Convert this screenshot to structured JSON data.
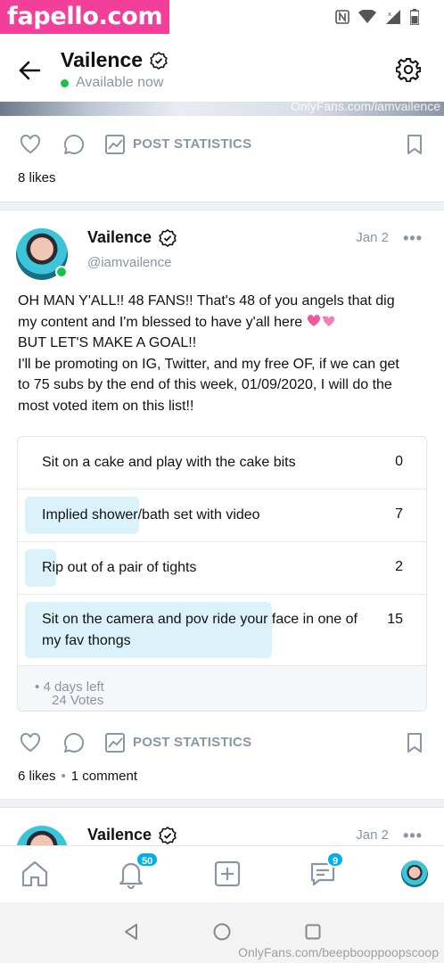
{
  "statusbar": {
    "brand": "fapello.com",
    "nfc_icon": "nfc-icon",
    "wifi_icon": "wifi-icon",
    "signal_icon": "signal-icon",
    "battery_icon": "battery-icon"
  },
  "header": {
    "back_icon": "arrow-left-icon",
    "name": "Vailence",
    "status": "Available now",
    "settings_icon": "gear-icon"
  },
  "media_strip": {
    "watermark": "OnlyFans.com/iamvailence"
  },
  "first_post": {
    "post_statistics_label": "POST STATISTICS",
    "likes": "8 likes"
  },
  "post": {
    "author": "Vailence",
    "handle": "@iamvailence",
    "date": "Jan 2",
    "more": "•••",
    "lines": [
      "OH MAN Y'ALL!! 48 FANS!! That's 48 of you angels that dig",
      "my content and I'm blessed to have y'all here",
      "BUT LET'S MAKE A GOAL!!",
      "I'll be promoting on IG, Twitter, and my free OF, if we can get",
      "to 75 subs by the end of this week, 01/09/2020, I will do the",
      "most voted item on this list!!"
    ],
    "poll": {
      "options": [
        {
          "label": "Sit on a cake and play with the cake bits",
          "votes": "0",
          "share": 0.0
        },
        {
          "label": "Implied shower/bath set with video",
          "votes": "7",
          "share": 0.29
        },
        {
          "label": "Rip out of a pair of tights",
          "votes": "2",
          "share": 0.08
        },
        {
          "label": "Sit on the camera and pov ride your face in one of my fav thongs",
          "votes": "15",
          "share": 0.63
        }
      ],
      "total_votes": "24 Votes",
      "separator": "•",
      "time_left": "4 days left"
    },
    "post_statistics_label": "POST STATISTICS",
    "likes": "6 likes",
    "dot": "•",
    "comments": "1 comment"
  },
  "next_post": {
    "author": "Vailence",
    "date": "Jan 2",
    "more": "•••"
  },
  "bottom_nav": {
    "home_icon": "home-icon",
    "notifications_icon": "bell-icon",
    "notifications_badge": "50",
    "add_icon": "plus-square-icon",
    "messages_icon": "chat-icon",
    "messages_badge": "9",
    "avatar": "profile-avatar"
  },
  "system_nav": {
    "watermark": "OnlyFans.com/beepbooppoopscoop"
  }
}
